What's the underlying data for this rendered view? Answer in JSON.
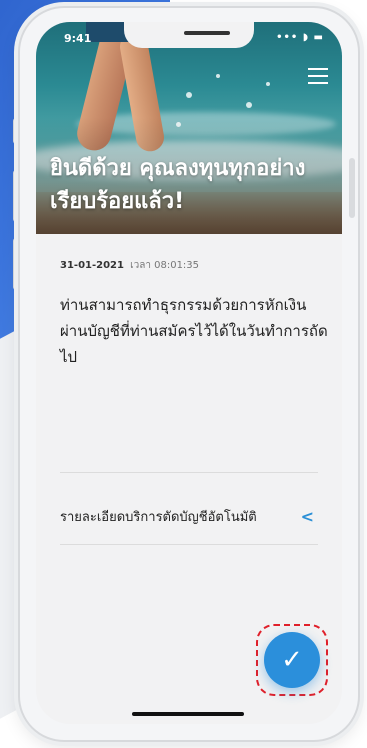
{
  "status_bar": {
    "time": "9:41",
    "icons": "••• ◗ ▬"
  },
  "hero": {
    "title": "ยินดีด้วย คุณลงทุนทุกอย่างเรียบร้อยแล้ว!"
  },
  "transaction": {
    "date": "31-01-2021",
    "time_label": "เวลา 08:01:35"
  },
  "message": "ท่านสามารถทำธุรกรรมด้วยการหักเงินผ่านบัญชีที่ท่านสมัครไว้ได้ในวันทำการถัดไป",
  "detail_link": {
    "label": "รายละเอียดบริการตัดบัญชีอัตโนมัติ",
    "chevron": "<"
  },
  "confirm_button": {
    "icon": "✓",
    "color": "#2b8fdb"
  },
  "icons": {
    "menu": "menu-icon",
    "chevron": "chevron-left-icon",
    "check": "check-icon"
  },
  "colors": {
    "accent": "#2b8fdb",
    "highlight": "#e0202a"
  }
}
